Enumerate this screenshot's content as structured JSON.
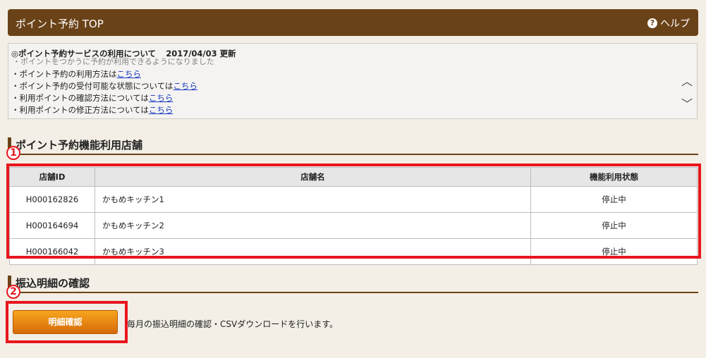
{
  "header": {
    "title": "ポイント予約 TOP",
    "help_label": "ヘルプ",
    "help_icon": "?"
  },
  "notice": {
    "title": "◎ポイント予約サービスの利用について",
    "date": "2017/04/03 更新",
    "cutoff_line": "・ポイントをつかうに予約が利用できるようになりました",
    "items": [
      {
        "text": "・ポイント予約の利用方法は",
        "link": "こちら"
      },
      {
        "text": "・ポイント予約の受付可能な状態については",
        "link": "こちら"
      },
      {
        "text": "・利用ポイントの確認方法については",
        "link": "こちら"
      },
      {
        "text": "・利用ポイントの修正方法については",
        "link": "こちら"
      }
    ],
    "scroll_up": "︿",
    "scroll_down": "﹀"
  },
  "section1": {
    "title": "ポイント予約機能利用店舗",
    "marker": "1"
  },
  "stores": {
    "headers": [
      "店舗ID",
      "店舗名",
      "機能利用状態"
    ],
    "rows": [
      {
        "id": "H000162826",
        "name": "かもめキッチン1",
        "status": "停止中"
      },
      {
        "id": "H000164694",
        "name": "かもめキッチン2",
        "status": "停止中"
      },
      {
        "id": "H000166042",
        "name": "かもめキッチン3",
        "status": "停止中"
      }
    ]
  },
  "section2": {
    "title": "振込明細の確認",
    "marker": "2"
  },
  "statement": {
    "button_label": "明細確認",
    "description": "毎月の振込明細の確認・CSVダウンロードを行います。"
  },
  "colors": {
    "header_bg": "#6a4218",
    "accent_red": "#e8161e",
    "button_orange": "#f08c14"
  }
}
